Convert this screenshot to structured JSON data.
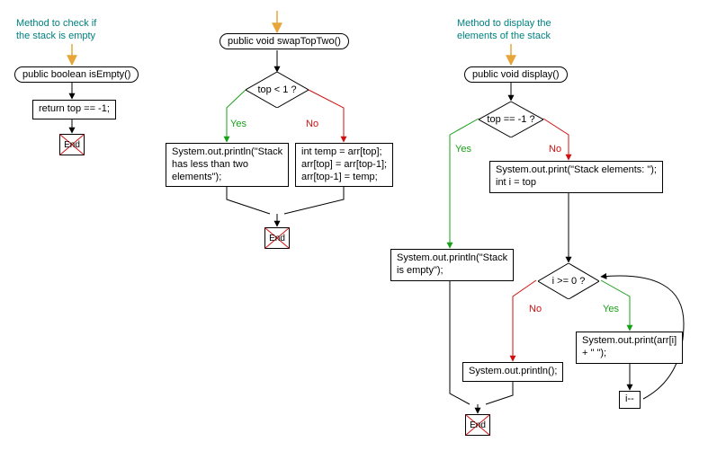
{
  "colors": {
    "comment": "#008080",
    "yes": "#18a018",
    "no": "#d01010",
    "arrow": "#e7a53a"
  },
  "fc1": {
    "comment": "Method to check if\nthe stack is empty",
    "signature": "public boolean isEmpty()",
    "body": "return top == -1;",
    "end": "End"
  },
  "fc2": {
    "signature": "public void swapTopTwo()",
    "condition": "top < 1 ?",
    "yes": "Yes",
    "no": "No",
    "yesBody": "System.out.println(\"Stack\nhas less than two\nelements\");",
    "noBody": "int temp = arr[top];\narr[top] = arr[top-1];\narr[top-1] = temp;",
    "end": "End"
  },
  "fc3": {
    "comment": "Method to display the\nelements of the stack",
    "signature": "public void display()",
    "condition1": "top == -1 ?",
    "yes": "Yes",
    "no": "No",
    "yesBody": "System.out.println(\"Stack\nis empty\");",
    "noBody1": "System.out.print(\"Stack elements: \");\nint i = top",
    "condition2": "i >= 0 ?",
    "loopBody": "System.out.print(arr[i]\n+ \" \");",
    "decrement": "i--",
    "afterLoop": "System.out.println();",
    "end": "End"
  }
}
